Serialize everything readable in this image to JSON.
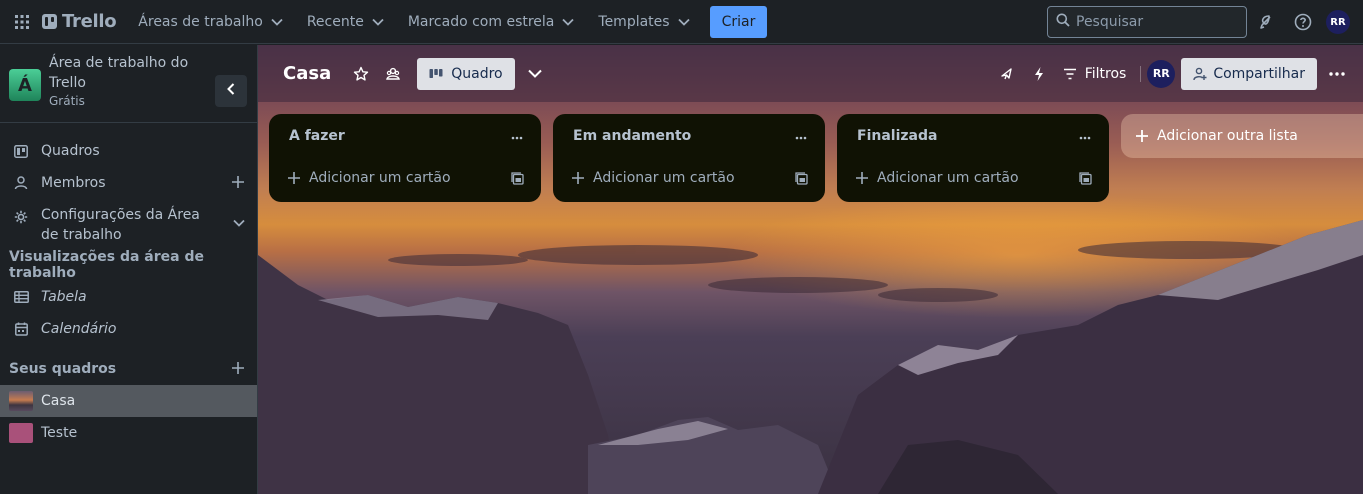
{
  "topbar": {
    "logo_text": "Trello",
    "menus": [
      "Áreas de trabalho",
      "Recente",
      "Marcado com estrela",
      "Templates"
    ],
    "create_label": "Criar",
    "search_placeholder": "Pesquisar",
    "avatar_initials": "RR"
  },
  "sidebar": {
    "workspace": {
      "badge": "Á",
      "name": "Área de trabalho do Trello",
      "plan": "Grátis"
    },
    "items": [
      {
        "label": "Quadros"
      },
      {
        "label": "Membros"
      },
      {
        "label": "Configurações da Área de trabalho"
      }
    ],
    "views_heading": "Visualizações da área de trabalho",
    "views": [
      {
        "label": "Tabela"
      },
      {
        "label": "Calendário"
      }
    ],
    "boards_heading": "Seus quadros",
    "boards": [
      {
        "label": "Casa",
        "active": true
      },
      {
        "label": "Teste",
        "active": false
      }
    ]
  },
  "board": {
    "title": "Casa",
    "view_label": "Quadro",
    "filters_label": "Filtros",
    "member_initials": "RR",
    "share_label": "Compartilhar",
    "lists": [
      {
        "title": "A fazer",
        "add_card_label": "Adicionar um cartão"
      },
      {
        "title": "Em andamento",
        "add_card_label": "Adicionar um cartão"
      },
      {
        "title": "Finalizada",
        "add_card_label": "Adicionar um cartão"
      }
    ],
    "add_list_label": "Adicionar outra lista"
  },
  "colors": {
    "accent": "#579dff",
    "background": "#1d2125",
    "list_bg": "#101204",
    "workspace_badge": "#4bce97"
  }
}
